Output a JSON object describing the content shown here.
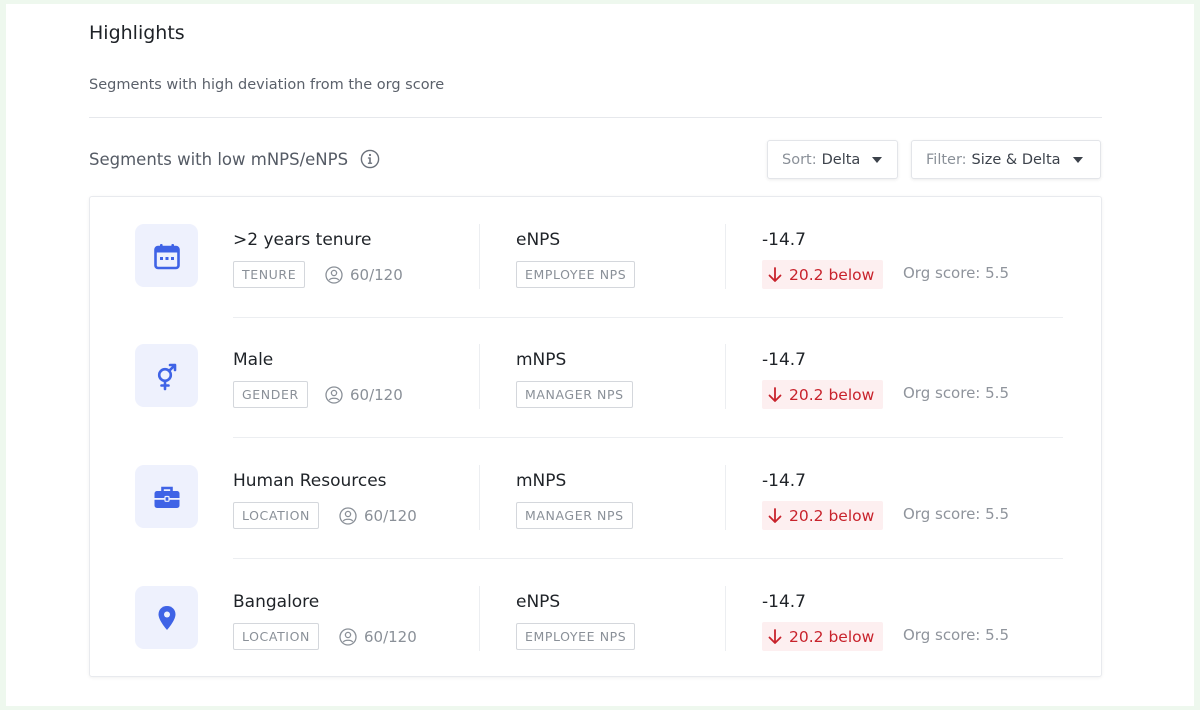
{
  "header": {
    "title": "Highlights",
    "subtitle": "Segments with high deviation from the org score"
  },
  "section": {
    "title": "Segments with low mNPS/eNPS",
    "sort": {
      "label": "Sort:",
      "value": "Delta"
    },
    "filter": {
      "label": "Filter:",
      "value": "Size & Delta"
    }
  },
  "colors": {
    "accent": "#3f63e6",
    "negative": "#c8232c",
    "negative_bg": "#fdeff0"
  },
  "rows": [
    {
      "icon": "calendar-icon",
      "name": ">2 years tenure",
      "category": "TENURE",
      "count": "60/120",
      "metric": "eNPS",
      "metric_tag": "EMPLOYEE NPS",
      "score": "-14.7",
      "delta": "20.2 below",
      "org_score": "Org score: 5.5"
    },
    {
      "icon": "gender-icon",
      "name": "Male",
      "category": "GENDER",
      "count": "60/120",
      "metric": "mNPS",
      "metric_tag": "MANAGER NPS",
      "score": "-14.7",
      "delta": "20.2 below",
      "org_score": "Org score: 5.5"
    },
    {
      "icon": "briefcase-icon",
      "name": "Human Resources",
      "category": "LOCATION",
      "count": "60/120",
      "metric": "mNPS",
      "metric_tag": "MANAGER NPS",
      "score": "-14.7",
      "delta": "20.2 below",
      "org_score": "Org score: 5.5"
    },
    {
      "icon": "location-pin-icon",
      "name": "Bangalore",
      "category": "LOCATION",
      "count": "60/120",
      "metric": "eNPS",
      "metric_tag": "EMPLOYEE NPS",
      "score": "-14.7",
      "delta": "20.2 below",
      "org_score": "Org score: 5.5"
    }
  ]
}
